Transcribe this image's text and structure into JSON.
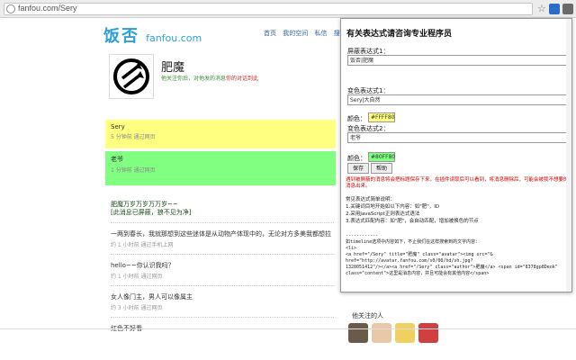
{
  "browser": {
    "url": "fanfou.com/Sery"
  },
  "site": {
    "logo_cn": "饭否",
    "logo_en": "fanfou.com",
    "nav": [
      "首页",
      "我的空间",
      "私信",
      "搜索"
    ]
  },
  "profile": {
    "name": "肥魔",
    "sub_prefix": "他关注你后，",
    "sub_link": "对他发的消息",
    "sub_red": "你的对话到此"
  },
  "statuses": [
    {
      "text": "Sery",
      "meta": "5 分钟前 通过网页"
    },
    {
      "text": "老爷",
      "meta": "1 分钟前 通过网页"
    }
  ],
  "feed": [
    {
      "text": "肥魔万岁万岁万万岁~~\n[此消息已屏蔽，狼不见为净]",
      "meta": "",
      "bold": true
    },
    {
      "text": "一两到春长，我就那想到这些迷体是从动物产体现中的，无论对方多美我都想拉",
      "meta": "约 1 小时前 通过手机上网"
    },
    {
      "text": "hello~~你认识我吗？",
      "meta": "约 1 小时前 通过网页"
    },
    {
      "text": "女人像门主，男人可以像属主",
      "meta": "约 3 小时前 通过网页"
    },
    {
      "text": "红色不好看",
      "meta": ""
    }
  ],
  "sidebar": {
    "follow_title": "他关注的人"
  },
  "popup": {
    "title": "有关表达式请咨询专业程序员",
    "label1": "屏蔽表达式1：",
    "field1": "饭否|肥魔",
    "label2": "变色表达式1：",
    "field2": "Sery|大自然",
    "color_label1": "颜色：",
    "color1": "#FFFF80",
    "label3": "变色表达式2：",
    "field3": "老爷",
    "color_label2": "颜色：",
    "color2": "#80FF80",
    "save_btn": "保存",
    "help_btn": "帮助",
    "hint_red": "遇到被屏蔽的消息将会把标题保存下来，在插件读取后可以看到，将消息删除后，可能会被我不想要的消息出来。",
    "hint1": "常见表达式简单说明：",
    "hint2": "1.关键词目地开始如以下内容：如\"肥\"，ID",
    "hint3": "2.采用JavaScript正则表达式语法",
    "hint4": "3.表达式匹配内容：如\"肥\"，会自动匹配，增加被换色的节点",
    "code": "------------\n如timeline选项中内容如下，不止我们在这样搜索到的文字内容：\n<li>\n<a href=\"/Sery\" title=\"肥魔\" class=\"avatar\"><img src=\"&\nhref=\"http://avatar.fanfou.com/s0/00/hd/vh.jpg?\n1328051412\"/></a><a href=\"/Sery\" class=\"author\">肥魔</a> <span id=\"8378gp8Deok\"\nclass=\"content\">这里是消息内容，并且可能会有其他内容</span>"
  },
  "colors": {
    "brand": "#2ca0d9",
    "yellow": "#ffff80",
    "green": "#80ff80"
  }
}
